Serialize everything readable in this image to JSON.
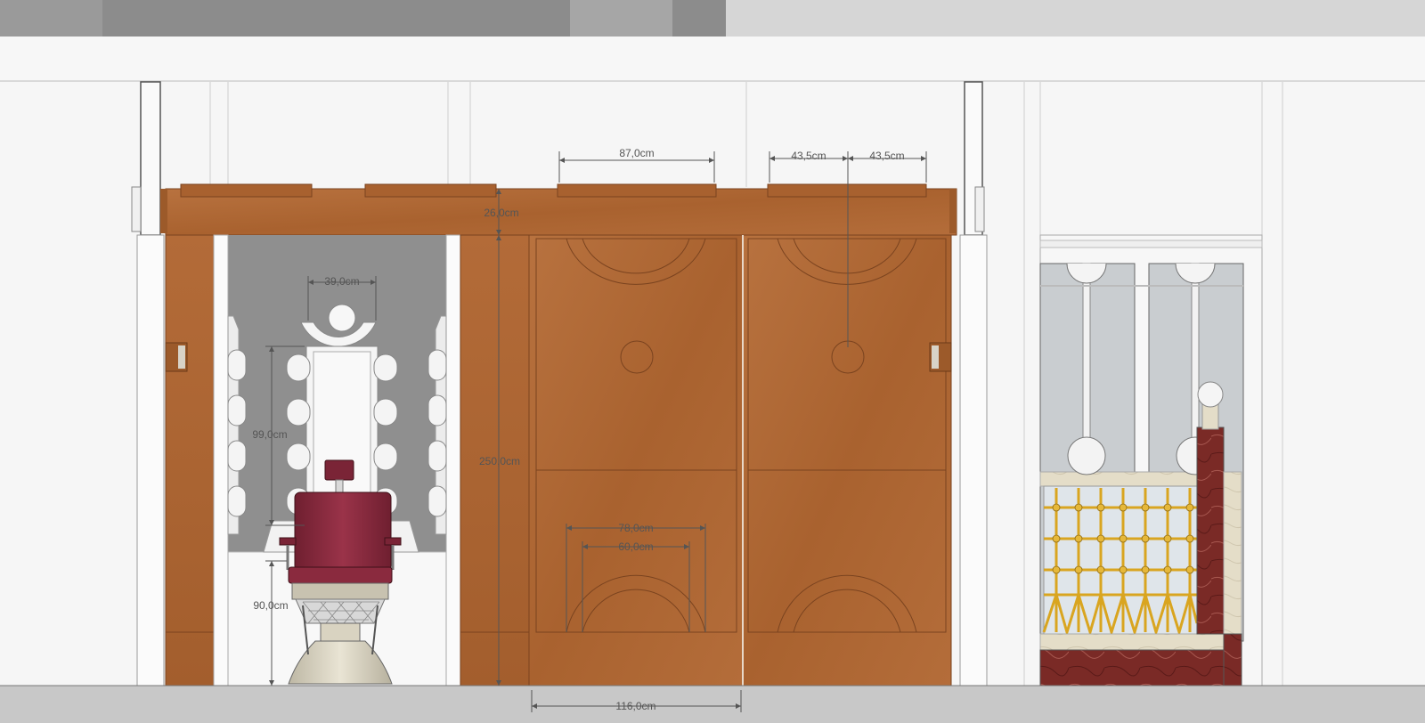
{
  "drawing": {
    "view": "front elevation",
    "colors": {
      "wall": "#f6f6f6",
      "wood": "#b06a3a",
      "wood_dark": "#8e5028",
      "alcove": "#909090",
      "chair": "#8a2a3e",
      "marble_red": "#7a2a26",
      "marble_cream": "#e4ddc8",
      "gold": "#d9a520",
      "glass": "#c9cdd0",
      "floor": "#c8c8c8",
      "top_dark": "#8c8c8c",
      "top_light": "#d6d6d6",
      "dimension_line": "#555555"
    },
    "dimensions": {
      "top_panel_width": "87,0cm",
      "half_width_left": "43,5cm",
      "half_width_right": "43,5cm",
      "cornice_height": "26,0cm",
      "mirror_width": "39,0cm",
      "mirror_height": "99,0cm",
      "total_height": "250,0cm",
      "arch_outer": "78,0cm",
      "arch_inner": "60,0cm",
      "counter_height": "90,0cm",
      "bottom_width": "116,0cm"
    },
    "elements": {
      "barber_chair": "barber-chair",
      "vanity_mirror": "vanity-mirror",
      "wood_doors": "wood-panel-doors",
      "display_cabinet": "marble-display-cabinet"
    }
  }
}
